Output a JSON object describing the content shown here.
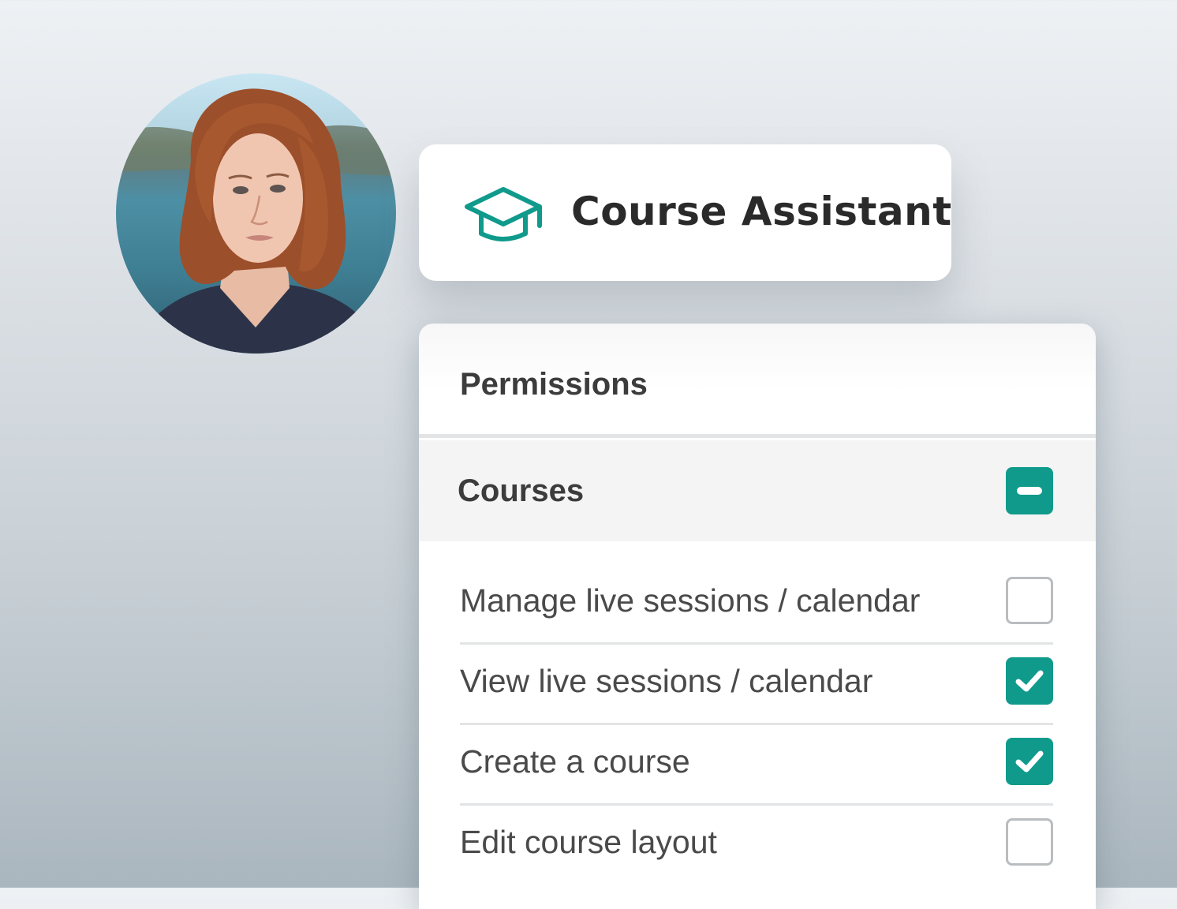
{
  "user": {
    "avatar_description": "avatar-photo"
  },
  "role": {
    "icon": "graduation-cap-icon",
    "title": "Course Assistant"
  },
  "permissions": {
    "title": "Permissions",
    "section": {
      "title": "Courses",
      "toggle_icon": "minus-icon",
      "items": [
        {
          "label": "Manage live sessions / calendar",
          "checked": false
        },
        {
          "label": "View live sessions / calendar",
          "checked": true
        },
        {
          "label": "Create a course",
          "checked": true
        },
        {
          "label": "Edit course layout",
          "checked": false
        }
      ]
    }
  },
  "colors": {
    "accent": "#0f9a8c",
    "text_dark": "#2a2a2a",
    "text": "#4a4a4a",
    "checkbox_border": "#b9bdc0",
    "section_bg": "#f4f4f4"
  }
}
